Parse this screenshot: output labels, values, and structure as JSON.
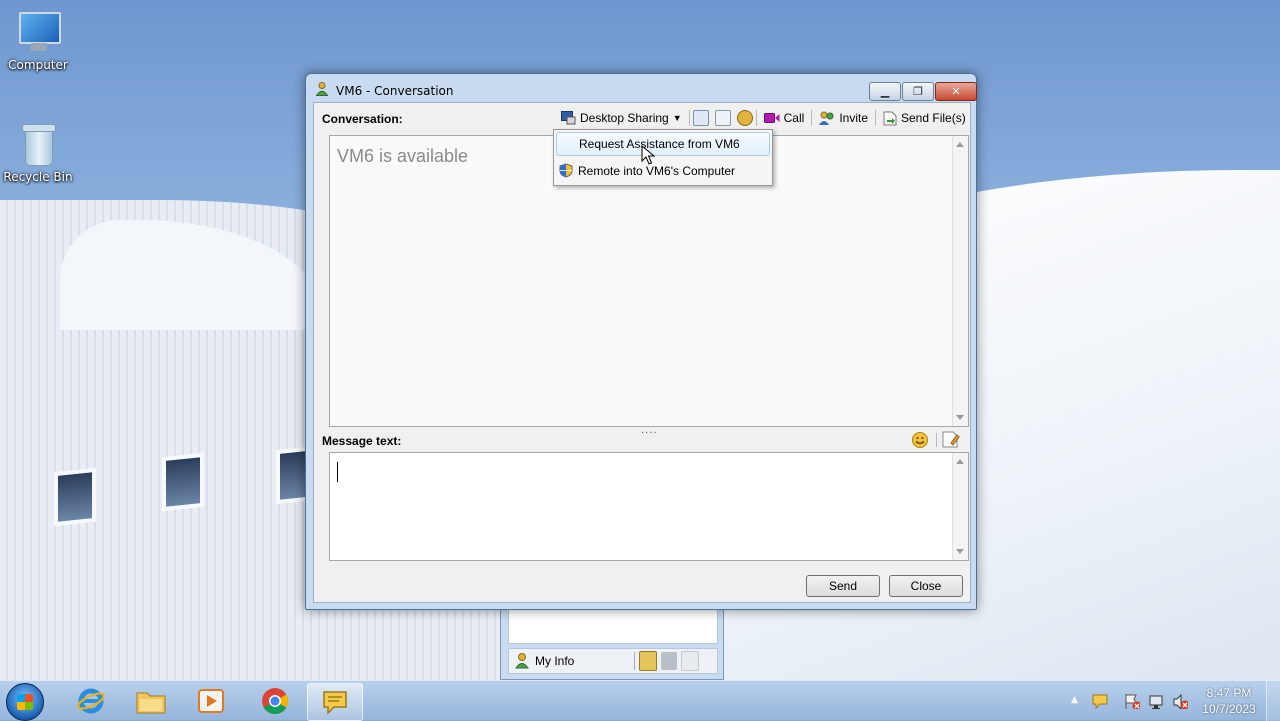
{
  "desktop": {
    "icons": [
      {
        "label": "Computer",
        "icon": "computer-icon"
      },
      {
        "label": "Recycle Bin",
        "icon": "recycle-bin-icon"
      }
    ]
  },
  "window": {
    "title": "VM6 - Conversation",
    "caption_min": "▁",
    "caption_max": "❐",
    "caption_close": "✕",
    "conversation_label": "Conversation:",
    "toolbar": {
      "desktop_sharing": "Desktop Sharing",
      "call": "Call",
      "invite": "Invite",
      "send_files": "Send File(s)"
    },
    "status_text": "VM6 is available",
    "splitter": "····",
    "message_label": "Message text:",
    "message_value": "",
    "send_button": "Send",
    "close_button": "Close"
  },
  "menu": {
    "items": [
      {
        "label": "Request Assistance from VM6",
        "highlighted": true
      },
      {
        "label": "Remote into VM6's Computer",
        "highlighted": false,
        "icon": "shield-icon"
      }
    ]
  },
  "contact_list": {
    "my_info": "My Info"
  },
  "taskbar": {
    "apps": [
      {
        "name": "internet-explorer-icon"
      },
      {
        "name": "file-explorer-icon"
      },
      {
        "name": "media-player-icon"
      },
      {
        "name": "chrome-icon"
      },
      {
        "name": "chat-app-icon",
        "active": true
      }
    ],
    "clock_time": "8:47 PM",
    "clock_date": "10/7/2023"
  },
  "colors": {
    "accent": "#4e6f96",
    "window_frame": "#c8dbf1",
    "close_red": "#c94b33"
  }
}
